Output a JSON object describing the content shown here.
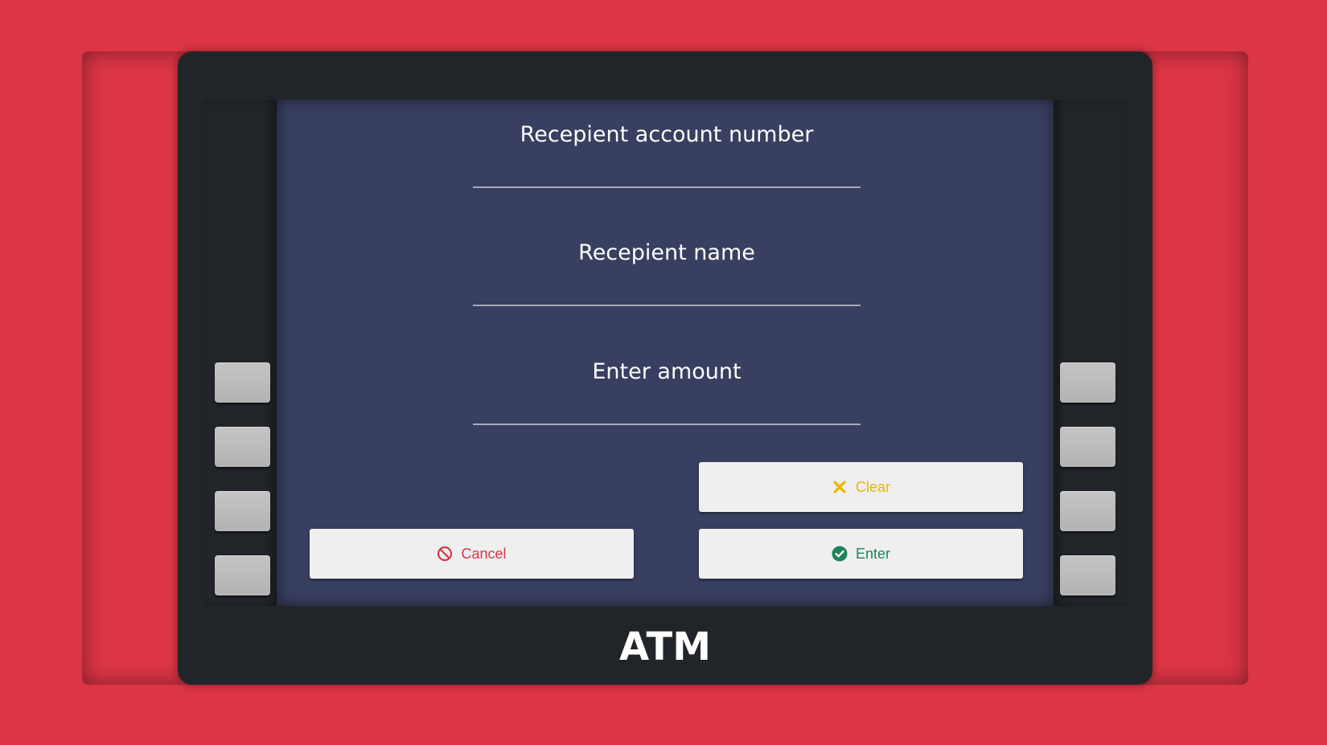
{
  "form": {
    "fields": [
      {
        "label": "Recepient account number",
        "value": ""
      },
      {
        "label": "Recepient name",
        "value": ""
      },
      {
        "label": "Enter amount",
        "value": ""
      }
    ]
  },
  "actions": {
    "clear_label": "Clear",
    "cancel_label": "Cancel",
    "enter_label": "Enter"
  },
  "machine": {
    "brand": "ATM",
    "side_buttons_per_column": 4
  },
  "colors": {
    "background": "#dc3545",
    "machine_body": "#212529",
    "screen": "#393f61",
    "clear_accent": "#f0b400",
    "cancel_accent": "#dc3545",
    "enter_accent": "#198754"
  },
  "icons": {
    "clear": "x-icon",
    "cancel": "ban-icon",
    "enter": "check-circle-icon"
  }
}
